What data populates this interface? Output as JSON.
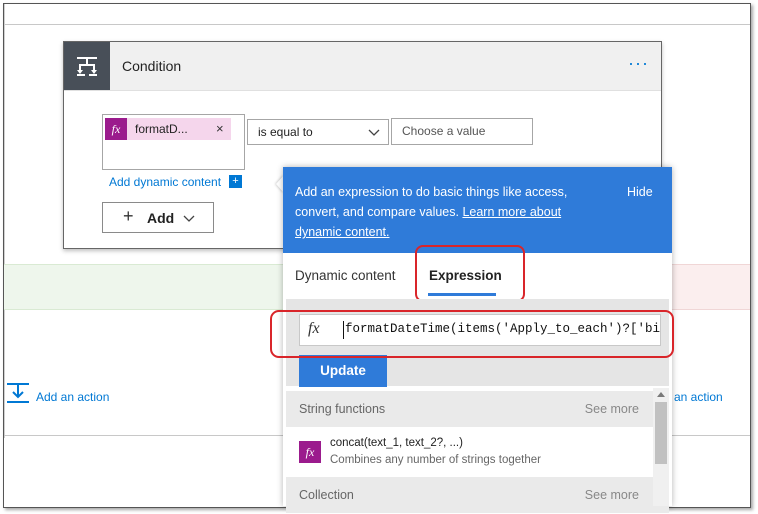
{
  "condition": {
    "title": "Condition",
    "more": "···",
    "token_label": "formatD...",
    "token_fx": "fx",
    "token_remove": "×",
    "operator": "is equal to",
    "value_placeholder": "Choose a value",
    "add_dynamic": "Add dynamic content",
    "add_dynamic_plus": "+",
    "add_button": "Add",
    "add_button_plus": "+"
  },
  "flow": {
    "add_action_left": "Add an action",
    "add_action_right": "an action"
  },
  "panel": {
    "description_pre": "Add an expression to do basic things like access, convert, and compare values. ",
    "description_link": "Learn more about dynamic content.",
    "hide": "Hide",
    "tabs": [
      {
        "label": "Dynamic content",
        "active": false
      },
      {
        "label": "Expression",
        "active": true
      }
    ],
    "expression_fx": "fx",
    "expression_value": "formatDateTime(items('Apply_to_each')?['bi",
    "update_button": "Update",
    "sections": [
      {
        "title": "String functions",
        "see_more": "See more",
        "items": [
          {
            "name": "concat(text_1, text_2?, ...)",
            "description": "Combines any number of strings together",
            "icon": "fx"
          }
        ]
      },
      {
        "title": "Collection",
        "see_more": "See more",
        "items": []
      }
    ]
  },
  "colors": {
    "accent": "#2f7bd9",
    "token": "#9b1b8d",
    "highlight": "#d9252a"
  }
}
